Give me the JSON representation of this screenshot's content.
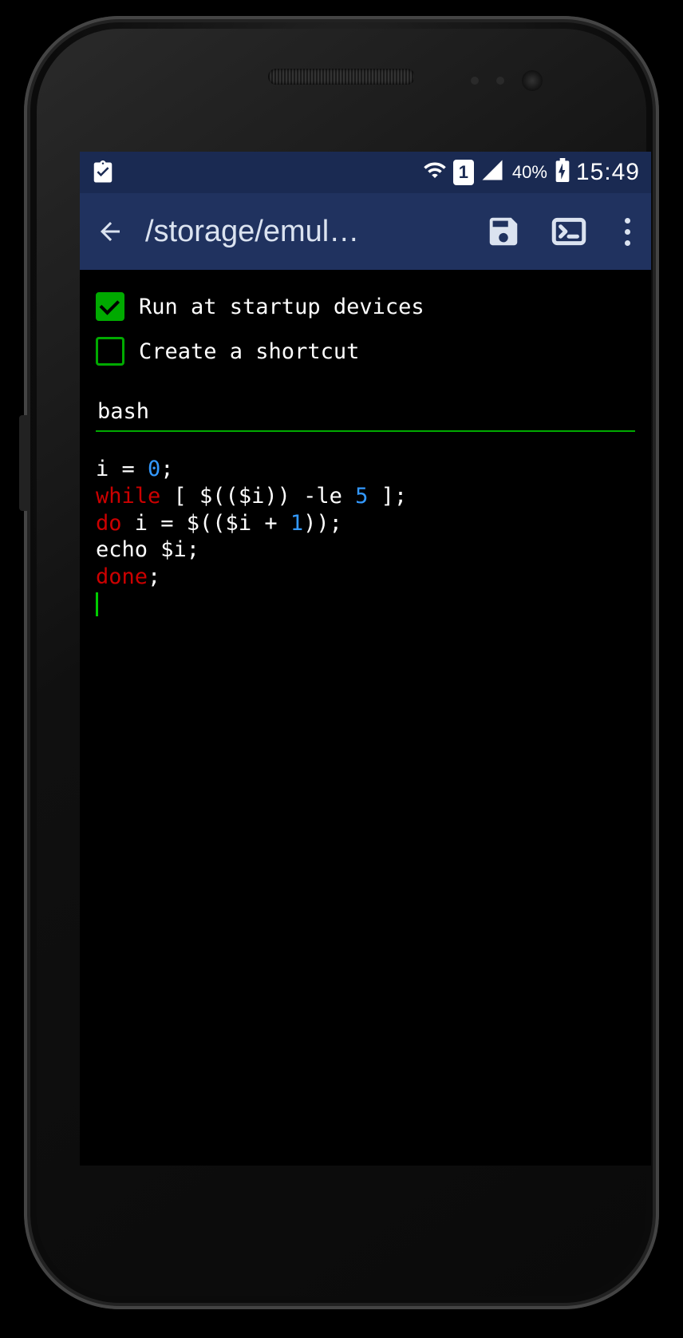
{
  "status": {
    "sim": "1",
    "battery_pct": "40%",
    "clock": "15:49"
  },
  "appbar": {
    "title": "/storage/emul…"
  },
  "options": {
    "run_startup": {
      "label": "Run at startup devices",
      "checked": true
    },
    "shortcut": {
      "label": "Create a shortcut",
      "checked": false
    }
  },
  "language_field": "bash",
  "code": {
    "lines": [
      [
        {
          "t": "i = ",
          "c": "txt"
        },
        {
          "t": "0",
          "c": "num"
        },
        {
          "t": ";",
          "c": "txt"
        }
      ],
      [
        {
          "t": "while",
          "c": "kw"
        },
        {
          "t": " [ $(($i)) -le ",
          "c": "txt"
        },
        {
          "t": "5",
          "c": "num"
        },
        {
          "t": " ];",
          "c": "txt"
        }
      ],
      [
        {
          "t": "do",
          "c": "kw"
        },
        {
          "t": " i = $(($i + ",
          "c": "txt"
        },
        {
          "t": "1",
          "c": "num"
        },
        {
          "t": "));",
          "c": "txt"
        }
      ],
      [
        {
          "t": "echo $i;",
          "c": "txt"
        }
      ],
      [
        {
          "t": "done",
          "c": "kw"
        },
        {
          "t": ";",
          "c": "txt"
        }
      ]
    ]
  }
}
